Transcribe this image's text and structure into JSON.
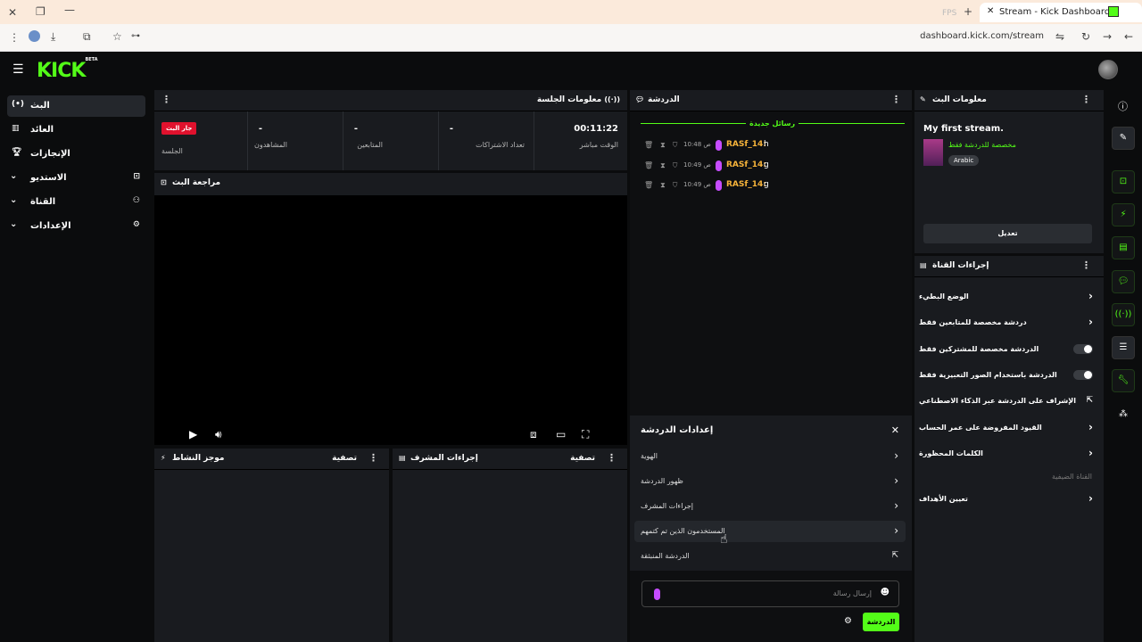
{
  "browser": {
    "tab_title": "Stream - Kick Dashboard",
    "tab_hint": "FPS",
    "url": "dashboard.kick.com/stream"
  },
  "brand": {
    "logo": "KICK",
    "beta": "BETA"
  },
  "leftnav": {
    "items": [
      {
        "label": "البث"
      },
      {
        "label": "العائد"
      },
      {
        "label": "الإنجازات"
      },
      {
        "label": "الاستديو"
      },
      {
        "label": "القناة"
      },
      {
        "label": "الإعدادات"
      }
    ]
  },
  "session": {
    "title": "معلومات الجلسة",
    "stats": [
      {
        "value": "00:11:22",
        "label": "الوقت مباشر"
      },
      {
        "value": "-",
        "label": "تعداد الاشتراكات"
      },
      {
        "value": "-",
        "label": "المتابعين"
      },
      {
        "value": "-",
        "label": "المشاهدون"
      },
      {
        "value": "جار البث",
        "label": "الجلسة"
      }
    ]
  },
  "preview": {
    "title": "مراجعة البث"
  },
  "activity": {
    "title": "موجز النشاط",
    "filter": "تصفية"
  },
  "mod_actions": {
    "title": "إجراءات المشرف",
    "filter": "تصفية"
  },
  "chat": {
    "title": "الدردشة",
    "new_messages": "رسائل جديدة",
    "messages": [
      {
        "time": "10:48 ص",
        "user": "RASf_14:",
        "text": "h"
      },
      {
        "time": "10:49 ص",
        "user": "RASf_14:",
        "text": "g"
      },
      {
        "time": "10:49 ص",
        "user": "RASf_14:",
        "text": "g"
      }
    ],
    "input_placeholder": "إرسال رسالة",
    "send_label": "الدردشة"
  },
  "chat_settings": {
    "title": "إعدادات الدردشة",
    "rows": [
      {
        "label": "الهوية"
      },
      {
        "label": "ظهور الدردشة"
      },
      {
        "label": "إجراءات المشرف"
      },
      {
        "label": "المستخدمون الذين تم كتمهم"
      },
      {
        "label": "الدردشة المنبثقة"
      }
    ]
  },
  "stream_info": {
    "title": "معلومات البث",
    "stream_title": "My first stream.",
    "category": "مخصصة للدردشة فقط",
    "language": "Arabic",
    "edit_label": "تعديل"
  },
  "channel_actions": {
    "title": "إجراءات القناة",
    "rows": [
      {
        "label": "الوضع البطيء"
      },
      {
        "label": "دردشة مخصصة للمتابعين فقط"
      },
      {
        "label": "الدردشة مخصصة للمشتركين فقط"
      },
      {
        "label": "الدردشة باستخدام الصور التعبيرية فقط"
      },
      {
        "label": "الإشراف على الدردشة عبر الذكاء الاصطناعي"
      },
      {
        "label": "القيود المفروضة على عمر الحساب"
      },
      {
        "label": "الكلمات المحظورة"
      }
    ],
    "section_label": "القناة الضيفية",
    "targets_label": "تعيين الأهداف"
  }
}
